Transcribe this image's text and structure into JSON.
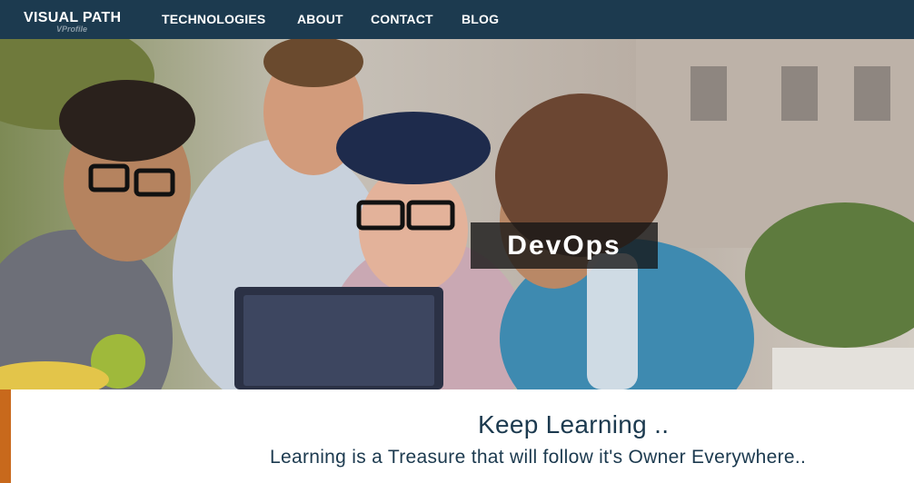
{
  "navbar": {
    "brand": "VISUAL PATH",
    "brand_sub": "VProfile",
    "items": [
      "TECHNOLOGIES",
      "ABOUT",
      "CONTACT",
      "BLOG"
    ]
  },
  "hero": {
    "caption": "DevOps"
  },
  "content": {
    "heading": "Keep Learning ..",
    "tagline": "Learning is a Treasure that will follow it's Owner Everywhere.."
  },
  "colors": {
    "navbar_bg": "#1c3a4f",
    "accent": "#c8691c",
    "text": "#1c3a4f"
  }
}
